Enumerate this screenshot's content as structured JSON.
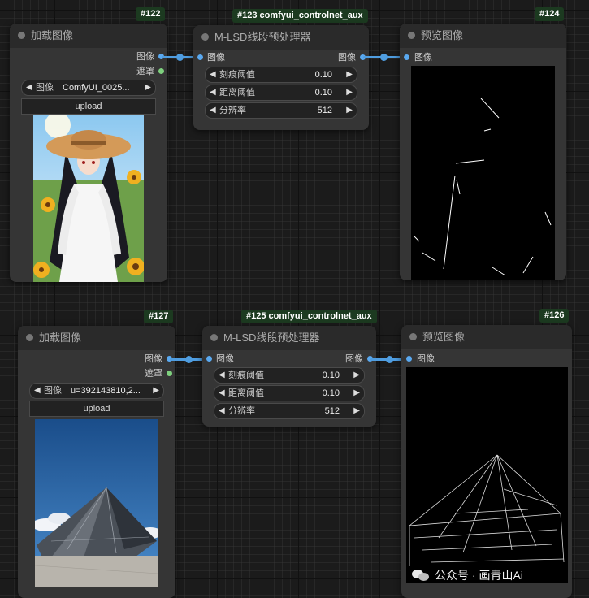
{
  "nodes": {
    "n122": {
      "badge": "#122",
      "title": "加载图像",
      "out_image": "图像",
      "out_mask": "遮罩",
      "image_label": "图像",
      "image_value": "ComfyUI_0025...",
      "upload": "upload"
    },
    "n123": {
      "badge": "#123 comfyui_controlnet_aux",
      "title": "M-LSD线段预处理器",
      "in_image": "图像",
      "out_image": "图像",
      "w1_label": "刻痕阈值",
      "w1_value": "0.10",
      "w2_label": "距离阈值",
      "w2_value": "0.10",
      "w3_label": "分辨率",
      "w3_value": "512"
    },
    "n124": {
      "badge": "#124",
      "title": "预览图像",
      "in_image": "图像"
    },
    "n127": {
      "badge": "#127",
      "title": "加载图像",
      "out_image": "图像",
      "out_mask": "遮罩",
      "image_label": "图像",
      "image_value": "u=392143810,2...",
      "upload": "upload"
    },
    "n125": {
      "badge": "#125 comfyui_controlnet_aux",
      "title": "M-LSD线段预处理器",
      "in_image": "图像",
      "out_image": "图像",
      "w1_label": "刻痕阈值",
      "w1_value": "0.10",
      "w2_label": "距离阈值",
      "w2_value": "0.10",
      "w3_label": "分辨率",
      "w3_value": "512"
    },
    "n126": {
      "badge": "#126",
      "title": "预览图像",
      "in_image": "图像"
    }
  },
  "watermark": "公众号 · 画青山Ai",
  "colors": {
    "link": "#4f9de0",
    "badge_bg": "#1c3a20",
    "node_bg": "#353535"
  }
}
